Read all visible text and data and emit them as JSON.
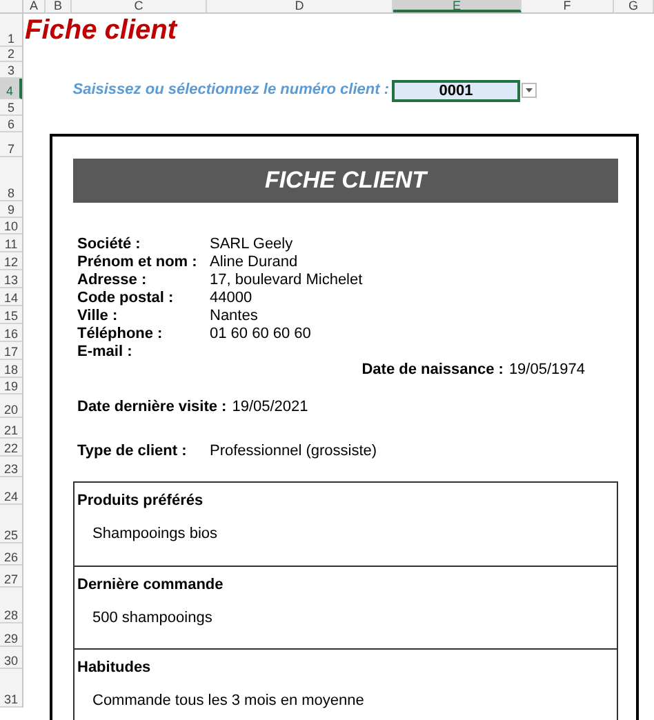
{
  "columns": [
    {
      "label": "A",
      "selected": false
    },
    {
      "label": "B",
      "selected": false
    },
    {
      "label": "C",
      "selected": false
    },
    {
      "label": "D",
      "selected": false
    },
    {
      "label": "E",
      "selected": true
    },
    {
      "label": "F",
      "selected": false
    },
    {
      "label": "G",
      "selected": false
    }
  ],
  "rows": [
    {
      "label": "1",
      "selected": false
    },
    {
      "label": "2",
      "selected": false
    },
    {
      "label": "3",
      "selected": false
    },
    {
      "label": "4",
      "selected": true
    },
    {
      "label": "5",
      "selected": false
    },
    {
      "label": "6",
      "selected": false
    },
    {
      "label": "7",
      "selected": false
    },
    {
      "label": "8",
      "selected": false
    },
    {
      "label": "9",
      "selected": false
    },
    {
      "label": "10",
      "selected": false
    },
    {
      "label": "11",
      "selected": false
    },
    {
      "label": "12",
      "selected": false
    },
    {
      "label": "13",
      "selected": false
    },
    {
      "label": "14",
      "selected": false
    },
    {
      "label": "15",
      "selected": false
    },
    {
      "label": "16",
      "selected": false
    },
    {
      "label": "17",
      "selected": false
    },
    {
      "label": "18",
      "selected": false
    },
    {
      "label": "19",
      "selected": false
    },
    {
      "label": "20",
      "selected": false
    },
    {
      "label": "21",
      "selected": false
    },
    {
      "label": "22",
      "selected": false
    },
    {
      "label": "23",
      "selected": false
    },
    {
      "label": "24",
      "selected": false
    },
    {
      "label": "25",
      "selected": false
    },
    {
      "label": "26",
      "selected": false
    },
    {
      "label": "27",
      "selected": false
    },
    {
      "label": "28",
      "selected": false
    },
    {
      "label": "29",
      "selected": false
    },
    {
      "label": "30",
      "selected": false
    },
    {
      "label": "31",
      "selected": false
    }
  ],
  "sheet_title": "Fiche client",
  "prompt": "Saisissez ou sélectionnez le numéro client :",
  "client_number": "0001",
  "card": {
    "header": "FICHE CLIENT",
    "fields": [
      {
        "label": "Société :",
        "value": "SARL Geely"
      },
      {
        "label": "Prénom et nom :",
        "value": "Aline Durand"
      },
      {
        "label": "Adresse :",
        "value": "17, boulevard Michelet"
      },
      {
        "label": "Code postal :",
        "value": "44000"
      },
      {
        "label": "Ville :",
        "value": "Nantes"
      },
      {
        "label": "Téléphone :",
        "value": "01 60 60 60 60"
      },
      {
        "label": "E-mail :"
      }
    ],
    "birth_date": {
      "label": "Date de naissance :",
      "value": "19/05/1974"
    },
    "last_visit": {
      "label": "Date dernière visite :",
      "value": "19/05/2021"
    },
    "client_type": {
      "label": "Type de client :",
      "value": "Professionnel (grossiste)"
    },
    "sections": [
      {
        "title": "Produits préférés",
        "text": "Shampooings bios"
      },
      {
        "title": "Dernière commande",
        "text": "500 shampooings"
      },
      {
        "title": "Habitudes",
        "text": "Commande tous les 3 mois en moyenne"
      }
    ]
  }
}
